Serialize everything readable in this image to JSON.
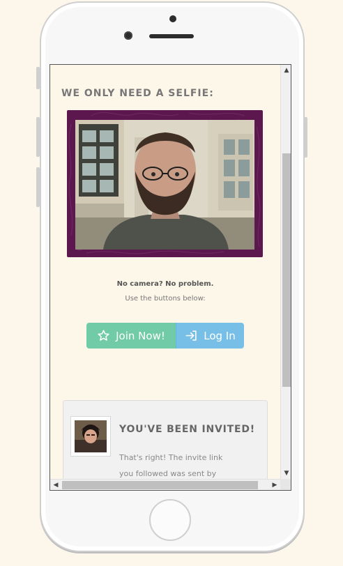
{
  "colors": {
    "page_background": "#fdf6ea",
    "video_frame": "#5c184e",
    "join_button": "#70cba6",
    "login_button": "#78bfe7",
    "heading_text": "#777777"
  },
  "selfie": {
    "heading": "WE ONLY NEED A SELFIE:"
  },
  "info": {
    "line1": "No camera? No problem.",
    "line2": "Use the buttons below:"
  },
  "buttons": {
    "join_label": "Join Now!",
    "join_icon": "star-icon",
    "login_label": "Log In",
    "login_icon": "sign-in-icon"
  },
  "invite": {
    "title": "YOU'VE BEEN INVITED!",
    "line1": "That's right! The invite link",
    "line2": "you followed was sent by"
  },
  "scrollbars": {
    "up_icon": "chevron-up-icon",
    "down_icon": "chevron-down-icon",
    "left_icon": "chevron-left-icon",
    "right_icon": "chevron-right-icon"
  }
}
